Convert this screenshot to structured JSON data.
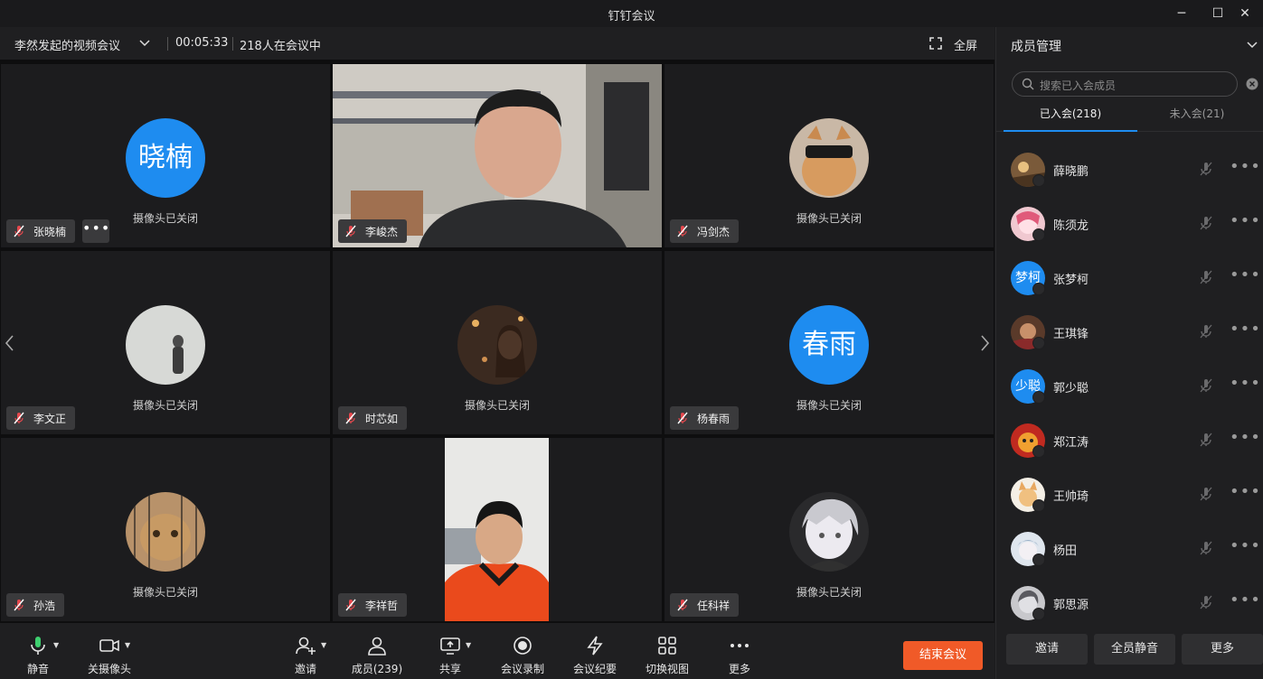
{
  "app_title": "钉钉会议",
  "window_controls": {
    "minimize": "─",
    "maximize": "☐",
    "close": "✕"
  },
  "meeting": {
    "title": "李然发起的视频会议",
    "timer": "00:05:33",
    "participants_text": "218人在会议中",
    "fullscreen_label": "全屏"
  },
  "camera_off_text": "摄像头已关闭",
  "tiles": [
    {
      "name": "张晓楠",
      "avatar_text": "晓楠",
      "camera": "off",
      "has_more": true
    },
    {
      "name": "李峻杰",
      "camera": "on"
    },
    {
      "name": "冯剑杰",
      "camera": "off"
    },
    {
      "name": "李文正",
      "camera": "off"
    },
    {
      "name": "时芯如",
      "camera": "off"
    },
    {
      "name": "杨春雨",
      "avatar_text": "春雨",
      "camera": "off"
    },
    {
      "name": "孙浩",
      "camera": "off"
    },
    {
      "name": "李祥哲",
      "camera": "on"
    },
    {
      "name": "任科祥",
      "camera": "off"
    }
  ],
  "more_label": "•••",
  "toolbar": {
    "mute": "静音",
    "camera": "关摄像头",
    "invite": "邀请",
    "members": "成员(239)",
    "share": "共享",
    "record": "会议录制",
    "minutes": "会议纪要",
    "switch_view": "切换视图",
    "more": "更多",
    "end": "结束会议"
  },
  "panel": {
    "title": "成员管理",
    "search_placeholder": "搜索已入会成员",
    "tab_joined": "已入会(218)",
    "tab_not_joined": "未入会(21)",
    "members": [
      {
        "name": "薛晓鹏"
      },
      {
        "name": "陈须龙"
      },
      {
        "name": "张梦柯",
        "avatar_text": "梦柯"
      },
      {
        "name": "王琪锋"
      },
      {
        "name": "郭少聪",
        "avatar_text": "少聪"
      },
      {
        "name": "郑江涛"
      },
      {
        "name": "王帅琦"
      },
      {
        "name": "杨田"
      },
      {
        "name": "郭思源"
      }
    ],
    "btn_invite": "邀请",
    "btn_mute_all": "全员静音",
    "btn_more": "更多"
  },
  "colors": {
    "accent": "#1e8cf0",
    "end_button": "#f05a28",
    "muted_red": "#e5484d"
  }
}
